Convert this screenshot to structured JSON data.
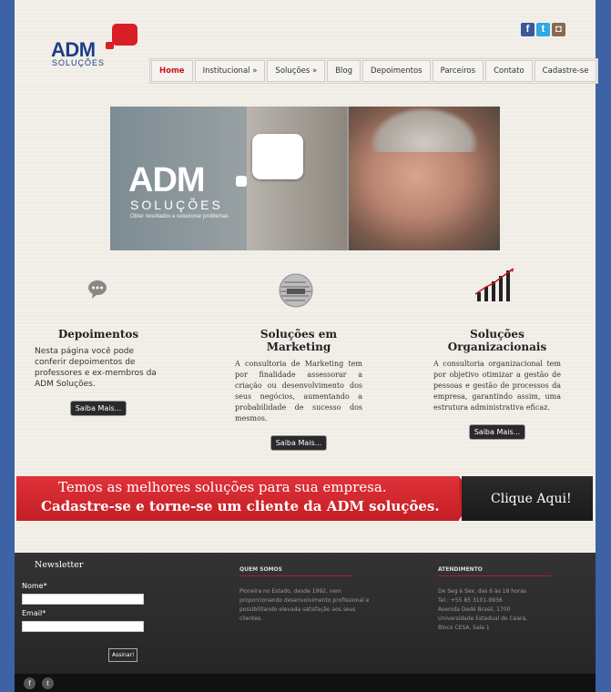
{
  "brand": {
    "name": "ADM",
    "sub": "SOLUÇÕES"
  },
  "social": [
    {
      "name": "facebook-icon",
      "glyph": "f",
      "color": "#3b5998"
    },
    {
      "name": "twitter-icon",
      "glyph": "t",
      "color": "#2fa8e4"
    },
    {
      "name": "instagram-icon",
      "glyph": "◘",
      "color": "#8a6a4e"
    }
  ],
  "nav": {
    "home": "Home",
    "institucional": "Institucional »",
    "solucoes": "Soluções »",
    "blog": "Blog",
    "depoimentos": "Depoimentos",
    "parceiros": "Parceiros",
    "contato": "Contato",
    "cadastre": "Cadastre-se"
  },
  "hero": {
    "brand": "ADM",
    "sub": "SOLUÇÕES",
    "tagline": "Obter resultados e solucionar problemas"
  },
  "columns": [
    {
      "title": "Depoimentos",
      "text": "Nesta página você pode conferir depoimentos de professores e ex-membros da ADM Soluções.",
      "button": "Saiba Mais...",
      "icon": "speech-bubble-icon"
    },
    {
      "title": "Soluções em Marketing",
      "text": "A consultoria de Marketing tem por finalidade assessorar a criação ou desenvolvimento dos seus negócios, aumentando a probabilidade de sucesso dos mesmos.",
      "button": "Saiba Mais...",
      "icon": "marketing-sphere-icon"
    },
    {
      "title": "Soluções Organizacionais",
      "text": "A consultoria organizacional tem por objetivo otimizar a gestão de pessoas e gestão de processos da empresa, garantindo assim, uma estrutura administrativa eficaz.",
      "button": "Saiba Mais...",
      "icon": "growth-chart-icon"
    }
  ],
  "banner": {
    "line1": "Temos as melhores soluções para sua empresa.",
    "line2": "Cadastre-se e torne-se um cliente da ADM soluções.",
    "cta": "Clique Aqui!"
  },
  "footer": {
    "newsletter": {
      "title": "Newsletter",
      "name_label": "Nome*",
      "email_label": "Email*",
      "submit": "Assinar!"
    },
    "about": {
      "title": "QUEM SOMOS",
      "text": "Pioneira no Estado, desde 1992, vem proporcionando desenvolvimento profissional e possibilitando elevada satisfação aos seus clientes."
    },
    "contact": {
      "title": "ATENDIMENTO",
      "lines": [
        "De Seg à Sex, das 6 às 18 horas",
        "Tel.: +55 85 3101-9936",
        "Avenida Dedé Brasil, 1700",
        "Universidade Estadual do Ceará,",
        "Bloco CESA, Sala 1"
      ]
    },
    "social": [
      {
        "name": "facebook-icon",
        "glyph": "f"
      },
      {
        "name": "twitter-icon",
        "glyph": "t"
      }
    ]
  },
  "colors": {
    "accent": "#c8141c",
    "brand_blue": "#1e3f86",
    "page_bg": "#3d62a6",
    "footer_bg": "#2b2b2b"
  }
}
